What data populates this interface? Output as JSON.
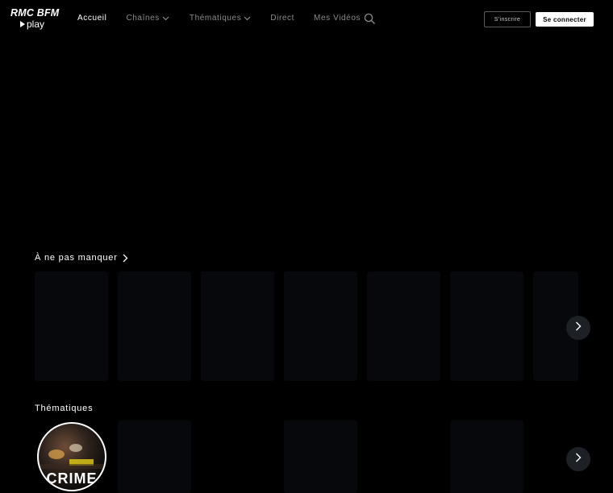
{
  "brand": {
    "logo_top": "RMC BFM",
    "logo_bottom": "play"
  },
  "nav": {
    "items": [
      {
        "label": "Accueil",
        "active": true,
        "dropdown": false
      },
      {
        "label": "Chaînes",
        "active": false,
        "dropdown": true
      },
      {
        "label": "Thématiques",
        "active": false,
        "dropdown": true
      },
      {
        "label": "Direct",
        "active": false,
        "dropdown": false
      },
      {
        "label": "Mes Vidéos",
        "active": false,
        "dropdown": false
      }
    ]
  },
  "header_actions": {
    "search_icon": "search-icon",
    "signup_label": "S'inscrire",
    "login_label": "Se connecter"
  },
  "sections": {
    "featured": {
      "title": "À ne pas manquer",
      "card_count": 7,
      "next_icon": "chevron-right-icon"
    },
    "themes": {
      "title": "Thématiques",
      "first_item_title": "CRIME",
      "next_icon": "chevron-right-icon"
    }
  },
  "colors": {
    "background": "#000000",
    "text": "#ffffff",
    "nav_inactive": "#8c8c8c",
    "card_placeholder": "#06080b",
    "nav_button_bg": "#1d2125"
  }
}
